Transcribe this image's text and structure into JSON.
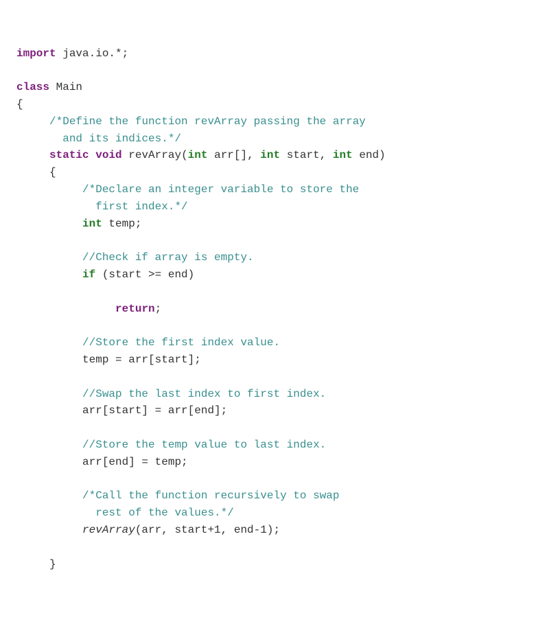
{
  "code": {
    "line01": {
      "kw_import": "import",
      "pkg": " java.io.*;"
    },
    "line02": "",
    "line03": {
      "kw_class": "class",
      "cls_name": " Main"
    },
    "line04": "{",
    "line05": {
      "indent": "     ",
      "c": "/*Define the function revArray passing the array"
    },
    "line06": {
      "indent": "       ",
      "c": "and its indices.*/"
    },
    "line07": {
      "indent": "     ",
      "kw_static": "static",
      "sp1": " ",
      "kw_void": "void",
      "sp2": " ",
      "fn": "revArray",
      "p_open": "(",
      "kw_int1": "int",
      "arg1": " arr[], ",
      "kw_int2": "int",
      "arg2": " start, ",
      "kw_int3": "int",
      "arg3": " end)",
      "_all": ""
    },
    "line08": {
      "indent": "     ",
      "brace": "{"
    },
    "line09": {
      "indent": "          ",
      "c": "/*Declare an integer variable to store the"
    },
    "line10": {
      "indent": "            ",
      "c": "first index.*/"
    },
    "line11": {
      "indent": "          ",
      "kw_int": "int",
      "rest": " temp;"
    },
    "line12": "",
    "line13": {
      "indent": "          ",
      "c": "//Check if array is empty."
    },
    "line14": {
      "indent": "          ",
      "kw_if": "if",
      "rest": " (start >= end)"
    },
    "line15": "",
    "line16": {
      "indent": "               ",
      "kw_ret": "return",
      "rest": ";"
    },
    "line17": "",
    "line18": {
      "indent": "          ",
      "c": "//Store the first index value."
    },
    "line19": {
      "indent": "          ",
      "txt": "temp = arr[start];"
    },
    "line20": "",
    "line21": {
      "indent": "          ",
      "c": "//Swap the last index to first index."
    },
    "line22": {
      "indent": "          ",
      "txt": "arr[start] = arr[end];"
    },
    "line23": "",
    "line24": {
      "indent": "          ",
      "c": "//Store the temp value to last index."
    },
    "line25": {
      "indent": "          ",
      "txt": "arr[end] = temp;"
    },
    "line26": "",
    "line27": {
      "indent": "          ",
      "c": "/*Call the function recursively to swap"
    },
    "line28": {
      "indent": "            ",
      "c": "rest of the values.*/"
    },
    "line29": {
      "indent": "          ",
      "fn": "revArray",
      "rest": "(arr, start+1, end-1);"
    },
    "line30": "",
    "line31": {
      "indent": "     ",
      "brace": "}"
    }
  }
}
